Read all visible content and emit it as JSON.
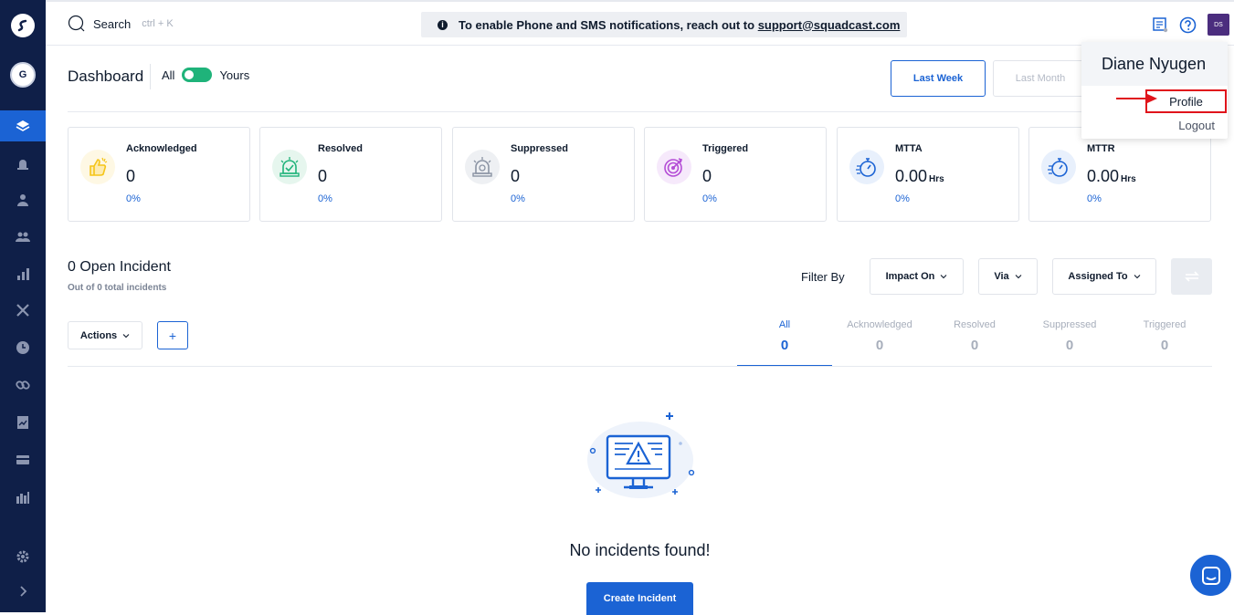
{
  "sidebar": {
    "org_initial": "G",
    "items": [
      {
        "icon": "layers-icon",
        "active": true
      },
      {
        "icon": "alarm-icon"
      },
      {
        "icon": "user-icon"
      },
      {
        "icon": "team-icon"
      },
      {
        "icon": "bar-chart-icon"
      },
      {
        "icon": "tools-icon"
      },
      {
        "icon": "clock-icon"
      },
      {
        "icon": "link-icon"
      },
      {
        "icon": "report-icon"
      },
      {
        "icon": "card-icon"
      },
      {
        "icon": "analytics-icon"
      }
    ],
    "bottom": [
      "gear-icon",
      "chevron-right-icon"
    ]
  },
  "topbar": {
    "search_label": "Search",
    "search_hint": "ctrl + K",
    "banner_text": "To enable Phone and SMS notifications, reach out to",
    "banner_link": "support@squadcast.com",
    "avatar_initials": "DS"
  },
  "dashboard": {
    "title": "Dashboard",
    "toggle_left": "All",
    "toggle_right": "Yours",
    "range_buttons": [
      "Last Week",
      "Last Month"
    ]
  },
  "cards": [
    {
      "title": "Acknowledged",
      "value": "0",
      "unit": "",
      "pct": "0%",
      "color": "#f5c518"
    },
    {
      "title": "Resolved",
      "value": "0",
      "unit": "",
      "pct": "0%",
      "color": "#1fb37a"
    },
    {
      "title": "Suppressed",
      "value": "0",
      "unit": "",
      "pct": "0%",
      "color": "#8a93a3"
    },
    {
      "title": "Triggered",
      "value": "0",
      "unit": "",
      "pct": "0%",
      "color": "#b44dd6"
    },
    {
      "title": "MTTA",
      "value": "0.00",
      "unit": "Hrs",
      "pct": "0%",
      "color": "#1b63d4"
    },
    {
      "title": "MTTR",
      "value": "0.00",
      "unit": "Hrs",
      "pct": "0%",
      "color": "#1b63d4"
    }
  ],
  "incidents": {
    "title": "0 Open Incident",
    "subtitle": "Out of 0 total incidents",
    "filter_label": "Filter By",
    "filters": [
      "Impact On",
      "Via",
      "Assigned To"
    ],
    "actions_label": "Actions",
    "add_label": "+",
    "tabs": [
      {
        "label": "All",
        "count": "0",
        "active": true
      },
      {
        "label": "Acknowledged",
        "count": "0"
      },
      {
        "label": "Resolved",
        "count": "0"
      },
      {
        "label": "Suppressed",
        "count": "0"
      },
      {
        "label": "Triggered",
        "count": "0"
      }
    ],
    "empty_text": "No incidents found!",
    "create_label": "Create Incident"
  },
  "user_menu": {
    "name": "Diane Nyugen",
    "profile": "Profile",
    "logout": "Logout"
  },
  "colors": {
    "accent": "#1b63d4",
    "sidebar": "#0f1f48",
    "highlight": "#e0141b"
  }
}
